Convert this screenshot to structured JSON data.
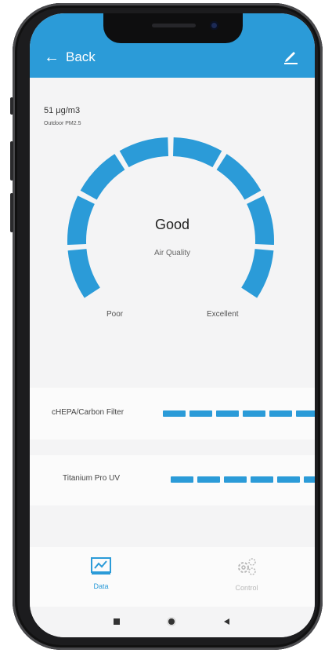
{
  "header": {
    "back_arrow": "←",
    "back_label": "Back",
    "edit_icon": "pencil-icon"
  },
  "outdoor": {
    "value": "51 μg/m3",
    "label": "Outdoor PM2.5"
  },
  "gauge": {
    "status": "Good",
    "label": "Air Quality",
    "min_label": "Poor",
    "max_label": "Excellent",
    "segments": 8,
    "color": "#2b9bd8"
  },
  "filters": [
    {
      "name": "cHEPA/Carbon Filter",
      "level_segments": 6
    },
    {
      "name": "Titanium Pro UV",
      "level_segments": 6
    }
  ],
  "tabs": {
    "data": {
      "label": "Data",
      "icon": "chart-icon",
      "active": true,
      "color": "#2b9bd8"
    },
    "control": {
      "label": "Control",
      "icon": "gears-icon",
      "active": false,
      "color": "#b8b8b8"
    }
  },
  "system_nav": {
    "recent": "square-icon",
    "home": "circle-icon",
    "back": "triangle-back-icon"
  },
  "colors": {
    "accent": "#2b9bd8",
    "background": "#f4f4f5"
  }
}
